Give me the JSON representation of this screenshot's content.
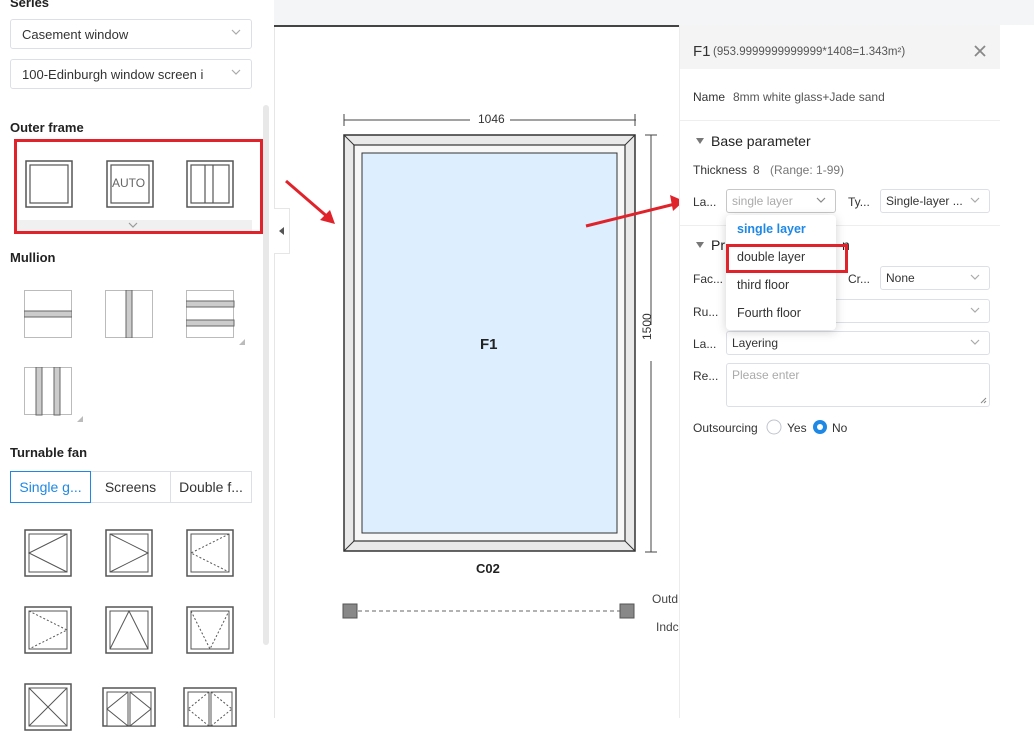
{
  "left": {
    "series_label": "Series",
    "series_select": "Casement window",
    "screen_select": "100-Edinburgh window screen i",
    "outer_frame_title": "Outer frame",
    "outer_frame_auto": "AUTO",
    "mullion_title": "Mullion",
    "turnable_title": "Turnable fan",
    "tabs": [
      "Single g...",
      "Screens",
      "Double f..."
    ]
  },
  "canvas": {
    "width_dim": "1046",
    "height_dim": "1500",
    "pane_label": "F1",
    "window_code": "C02",
    "outdoor_label": "Outd",
    "indoor_label": "Indc"
  },
  "panel": {
    "title": "F1",
    "title_calc": "(953.9999999999999*1408=1.343m²)",
    "name_label": "Name",
    "name_value": "8mm white glass+Jade sand",
    "base_param": "Base parameter",
    "thickness_label": "Thickness",
    "thickness_value": "8",
    "thickness_range": "(Range: 1-99)",
    "layer_label": "La...",
    "layer_placeholder": "single layer",
    "type_label": "Ty...",
    "type_value": "Single-layer ...",
    "processing_title_a": "Pr",
    "processing_title_b": "n",
    "face_label": "Fac...",
    "craft_label": "Cr...",
    "craft_value": "None",
    "rule_label": "Ru...",
    "layering_label": "La...",
    "layering_value": "Layering",
    "remark_label": "Re...",
    "remark_placeholder": "Please enter",
    "outsourcing_label": "Outsourcing",
    "yes_label": "Yes",
    "no_label": "No"
  },
  "dropdown_options": [
    "single layer",
    "double layer",
    "third floor",
    "Fourth floor"
  ],
  "colors": {
    "accent": "#1e88e5",
    "highlight": "#e0232b",
    "glass": "#ddeeff"
  }
}
